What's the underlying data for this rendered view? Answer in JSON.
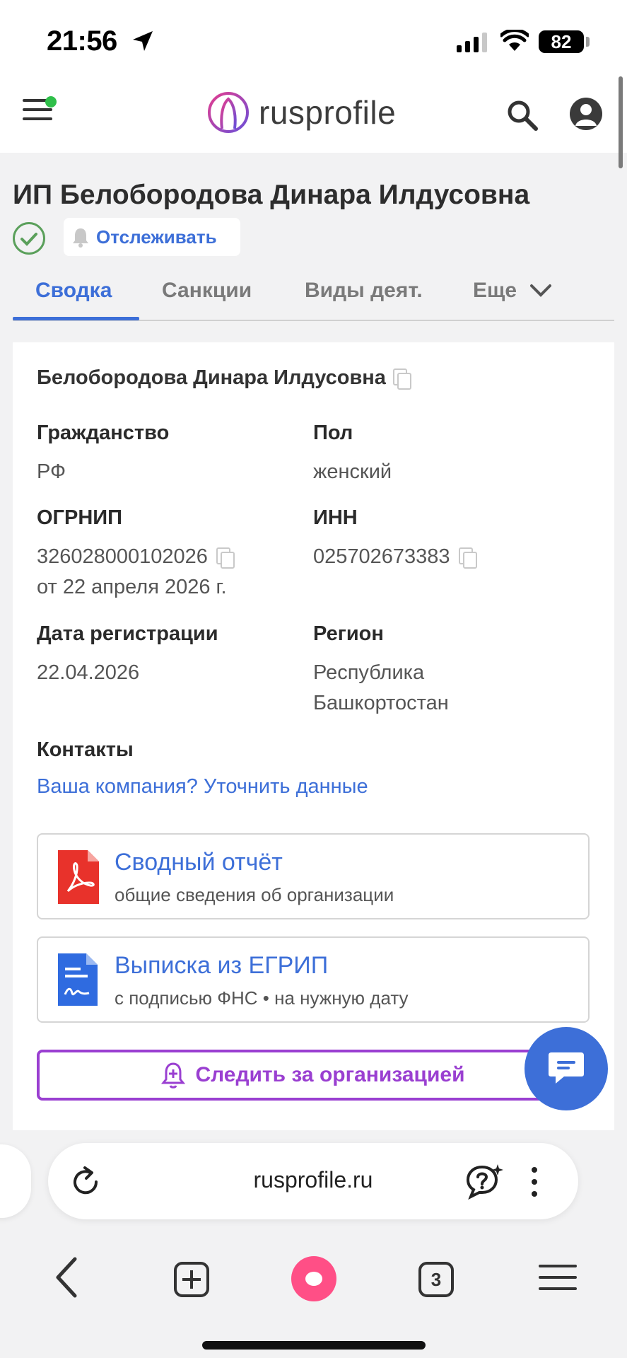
{
  "status_bar": {
    "time": "21:56",
    "battery": "82"
  },
  "header": {
    "logo_text": "rusprofile",
    "icons": [
      "menu-icon",
      "search-icon",
      "user-icon"
    ]
  },
  "company": {
    "title": "ИП Белобородова Динара Илдусовна",
    "track_label": "Отслеживать"
  },
  "tabs": [
    {
      "label": "Сводка",
      "active": true
    },
    {
      "label": "Санкции"
    },
    {
      "label": "Виды деят."
    },
    {
      "label": "Еще"
    }
  ],
  "card": {
    "full_name": "Белобородова Динара Илдусовна",
    "citizenship": {
      "label": "Гражданство",
      "value": "РФ"
    },
    "gender": {
      "label": "Пол",
      "value": "женский"
    },
    "ogrnip": {
      "label": "ОГРНИП",
      "value": "326028000102026",
      "date": "от 22 апреля 2026 г."
    },
    "inn": {
      "label": "ИНН",
      "value": "025702673383"
    },
    "reg_date": {
      "label": "Дата регистрации",
      "value": "22.04.2026"
    },
    "region": {
      "label": "Регион",
      "value_line1": "Республика",
      "value_line2": "Башкортостан"
    },
    "contacts": {
      "label": "Контакты",
      "link": "Ваша компания? Уточнить данные"
    },
    "summary_report": {
      "title": "Сводный отчёт",
      "subtitle": "общие сведения об организации"
    },
    "egrip": {
      "title": "Выписка из ЕГРИП",
      "subtitle": "с подписью ФНС • на нужную дату"
    },
    "follow_label": "Следить за организацией"
  },
  "browser": {
    "url": "rusprofile.ru",
    "tab_count": "3"
  },
  "colors": {
    "accent": "#3d6fd8",
    "purple": "#9a3fd1",
    "pdf_red": "#e8322b",
    "alice": "#ff4f86"
  }
}
